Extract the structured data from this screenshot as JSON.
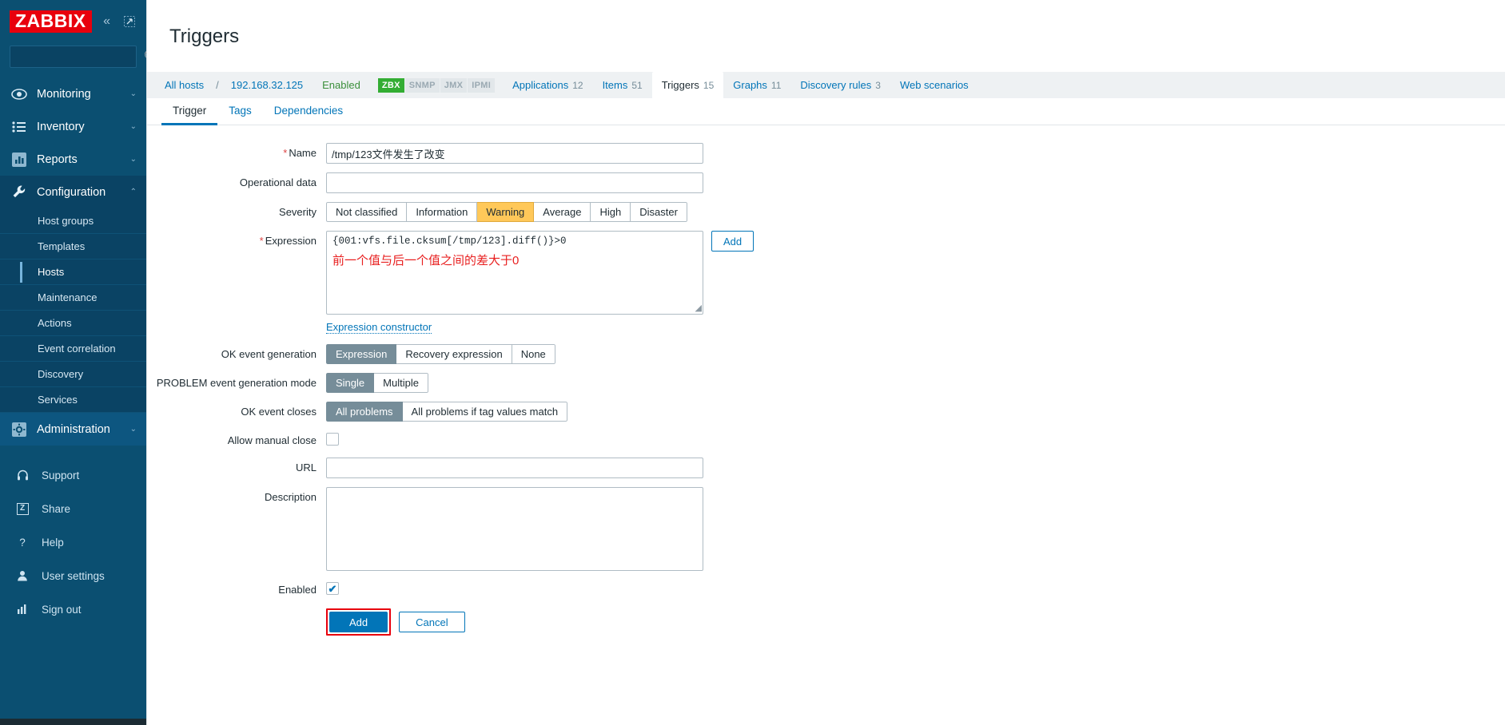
{
  "sidebar": {
    "logo": "ZABBIX",
    "collapse_icon": "chevron-double-left-icon",
    "expand_icon": "expand-icon",
    "search": {
      "value": "",
      "placeholder": "",
      "icon": "search-icon"
    },
    "nav": [
      {
        "label": "Monitoring",
        "icon": "eye-icon",
        "chevron": "⌄",
        "expanded": false
      },
      {
        "label": "Inventory",
        "icon": "list-icon",
        "chevron": "⌄",
        "expanded": false
      },
      {
        "label": "Reports",
        "icon": "bar-chart-icon",
        "chevron": "⌄",
        "expanded": false
      },
      {
        "label": "Configuration",
        "icon": "wrench-icon",
        "chevron": "⌃",
        "expanded": true
      },
      {
        "label": "Administration",
        "icon": "gear-icon",
        "chevron": "⌄",
        "expanded": false
      }
    ],
    "configuration_children": [
      {
        "label": "Host groups",
        "active": false
      },
      {
        "label": "Templates",
        "active": false
      },
      {
        "label": "Hosts",
        "active": true
      },
      {
        "label": "Maintenance",
        "active": false
      },
      {
        "label": "Actions",
        "active": false
      },
      {
        "label": "Event correlation",
        "active": false
      },
      {
        "label": "Discovery",
        "active": false
      },
      {
        "label": "Services",
        "active": false
      }
    ],
    "utility": [
      {
        "label": "Support",
        "icon": "headset-icon"
      },
      {
        "label": "Share",
        "icon": "share-z-icon"
      },
      {
        "label": "Help",
        "icon": "question-icon"
      },
      {
        "label": "User settings",
        "icon": "user-icon"
      },
      {
        "label": "Sign out",
        "icon": "signout-icon"
      }
    ]
  },
  "header": {
    "title": "Triggers"
  },
  "breadcrumb": {
    "all_hosts": "All hosts",
    "separator": "/",
    "host": "192.168.32.125",
    "status": "Enabled",
    "protocols": [
      {
        "label": "ZBX",
        "enabled": true
      },
      {
        "label": "SNMP",
        "enabled": false
      },
      {
        "label": "JMX",
        "enabled": false
      },
      {
        "label": "IPMI",
        "enabled": false
      }
    ],
    "entity_tabs": [
      {
        "label": "Applications",
        "count": "12",
        "active": false
      },
      {
        "label": "Items",
        "count": "51",
        "active": false
      },
      {
        "label": "Triggers",
        "count": "15",
        "active": true
      },
      {
        "label": "Graphs",
        "count": "11",
        "active": false
      },
      {
        "label": "Discovery rules",
        "count": "3",
        "active": false
      },
      {
        "label": "Web scenarios",
        "count": "",
        "active": false
      }
    ]
  },
  "form_tabs": [
    {
      "label": "Trigger",
      "active": true
    },
    {
      "label": "Tags",
      "active": false
    },
    {
      "label": "Dependencies",
      "active": false
    }
  ],
  "form": {
    "name": {
      "label": "Name",
      "required": true,
      "value": "/tmp/123文件发生了改变",
      "placeholder": ""
    },
    "operational_data": {
      "label": "Operational data",
      "value": "",
      "placeholder": ""
    },
    "severity": {
      "label": "Severity",
      "options": [
        "Not classified",
        "Information",
        "Warning",
        "Average",
        "High",
        "Disaster"
      ],
      "selected": "Warning",
      "selected_color": "#ffc859"
    },
    "expression": {
      "label": "Expression",
      "required": true,
      "value": "{001:vfs.file.cksum[/tmp/123].diff()}>0",
      "annotation": "前一个值与后一个值之间的差大于0",
      "annotation_color": "#e82020",
      "add_button": "Add",
      "constructor_link": "Expression constructor"
    },
    "ok_event_generation": {
      "label": "OK event generation",
      "options": [
        "Expression",
        "Recovery expression",
        "None"
      ],
      "selected": "Expression"
    },
    "problem_event_generation_mode": {
      "label": "PROBLEM event generation mode",
      "options": [
        "Single",
        "Multiple"
      ],
      "selected": "Single"
    },
    "ok_event_closes": {
      "label": "OK event closes",
      "options": [
        "All problems",
        "All problems if tag values match"
      ],
      "selected": "All problems"
    },
    "allow_manual_close": {
      "label": "Allow manual close",
      "checked": false
    },
    "url": {
      "label": "URL",
      "value": "",
      "placeholder": ""
    },
    "description": {
      "label": "Description",
      "value": "",
      "placeholder": ""
    },
    "enabled": {
      "label": "Enabled",
      "checked": true,
      "tick": "✔"
    }
  },
  "footer": {
    "submit_label": "Add",
    "cancel_label": "Cancel",
    "highlight_color": "#e8000d"
  }
}
